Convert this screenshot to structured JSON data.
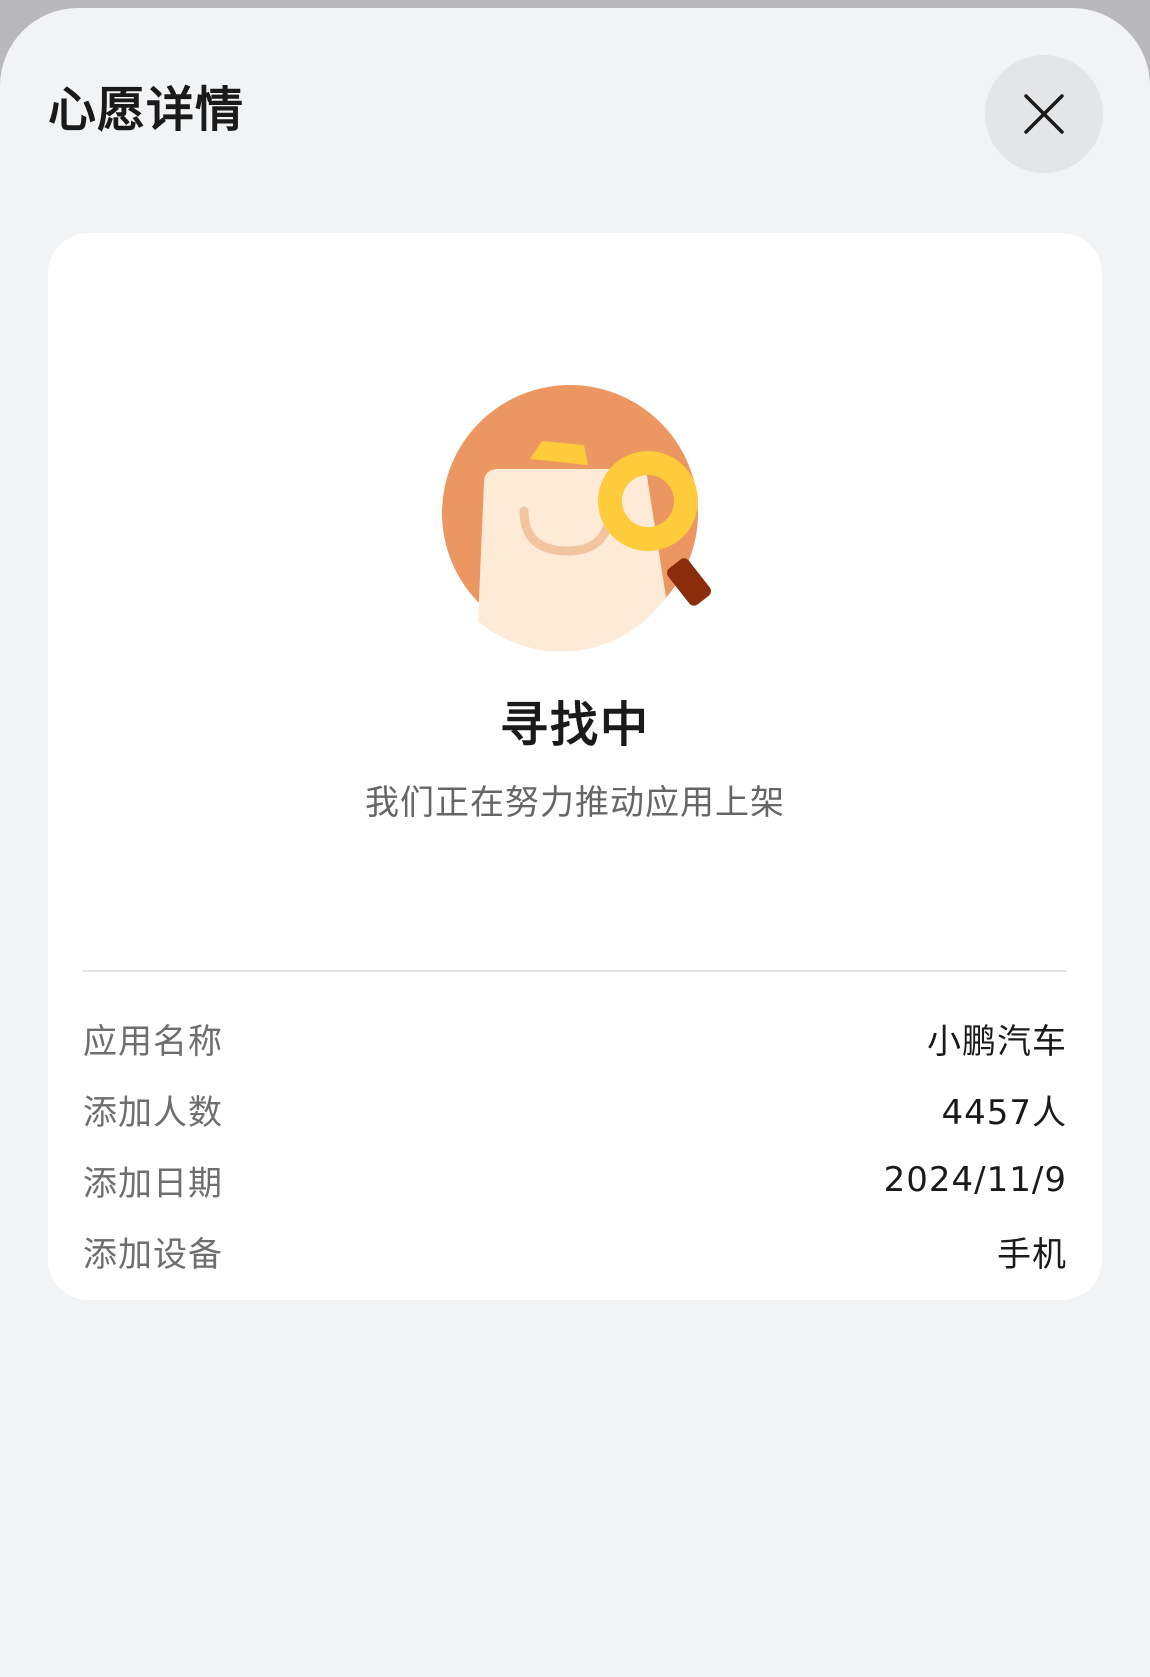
{
  "sheet": {
    "title": "心愿详情",
    "close_icon": "close-icon"
  },
  "status": {
    "illustration_icon": "shopping-bag-search-illustration",
    "title": "寻找中",
    "subtitle": "我们正在努力推动应用上架"
  },
  "details": [
    {
      "label": "应用名称",
      "value": "小鹏汽车"
    },
    {
      "label": "添加人数",
      "value": "4457人"
    },
    {
      "label": "添加日期",
      "value": "2024/11/9"
    },
    {
      "label": "添加设备",
      "value": "手机"
    }
  ],
  "colors": {
    "sheet_background": "#f1f3f5",
    "card_background": "#ffffff",
    "illustration_orange": "#ec9761",
    "illustration_bag": "#fdebd8",
    "illustration_yellow": "#fecb3a",
    "illustration_handle": "#8b2d0a"
  }
}
